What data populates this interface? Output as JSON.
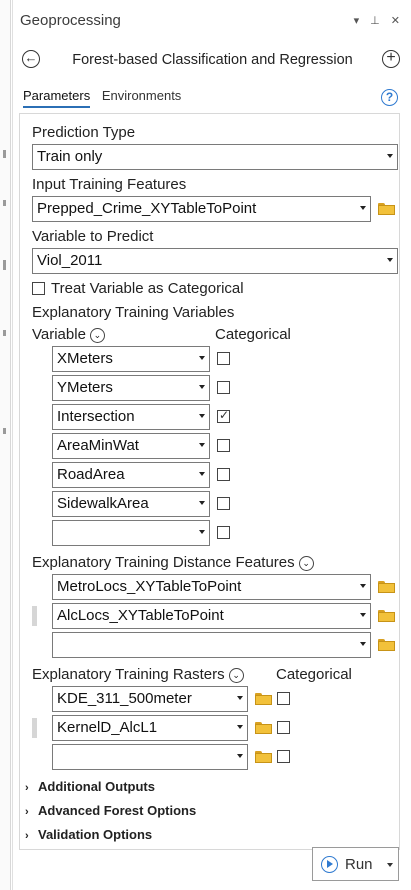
{
  "pane": {
    "title": "Geoprocessing",
    "controls": "▾ ⊥ ✕"
  },
  "tool": {
    "name": "Forest-based Classification and Regression"
  },
  "tabs": [
    {
      "label": "Parameters"
    },
    {
      "label": "Environments"
    }
  ],
  "help": "?",
  "prediction_type": {
    "label": "Prediction Type",
    "value": "Train only"
  },
  "input_training_features": {
    "label": "Input Training Features",
    "value": "Prepped_Crime_XYTableToPoint"
  },
  "variable_to_predict": {
    "label": "Variable to Predict",
    "value": "Viol_2011"
  },
  "treat_categorical": {
    "label": "Treat Variable as Categorical",
    "checked": false
  },
  "explanatory_variables": {
    "label": "Explanatory Training Variables",
    "col_variable": "Variable",
    "col_categorical": "Categorical",
    "rows": [
      {
        "value": "XMeters",
        "checked": false
      },
      {
        "value": "YMeters",
        "checked": false
      },
      {
        "value": "Intersection",
        "checked": true
      },
      {
        "value": "AreaMinWat",
        "checked": false
      },
      {
        "value": "RoadArea",
        "checked": false
      },
      {
        "value": "SidewalkArea",
        "checked": false
      },
      {
        "value": "",
        "checked": false
      }
    ]
  },
  "distance_features": {
    "label": "Explanatory Training Distance Features",
    "rows": [
      {
        "value": "MetroLocs_XYTableToPoint"
      },
      {
        "value": "AlcLocs_XYTableToPoint"
      },
      {
        "value": ""
      }
    ]
  },
  "rasters": {
    "label": "Explanatory Training Rasters",
    "col_categorical": "Categorical",
    "rows": [
      {
        "value": "KDE_311_500meter",
        "checked": false
      },
      {
        "value": "KernelD_AlcL1",
        "checked": false
      },
      {
        "value": "",
        "checked": false
      }
    ]
  },
  "sections": [
    {
      "label": "Additional Outputs"
    },
    {
      "label": "Advanced Forest Options"
    },
    {
      "label": "Validation Options"
    }
  ],
  "run": {
    "label": "Run"
  },
  "colors": {
    "accent": "#2f7ad0",
    "border": "#7a7a7a",
    "folder": "#f2c13a"
  }
}
